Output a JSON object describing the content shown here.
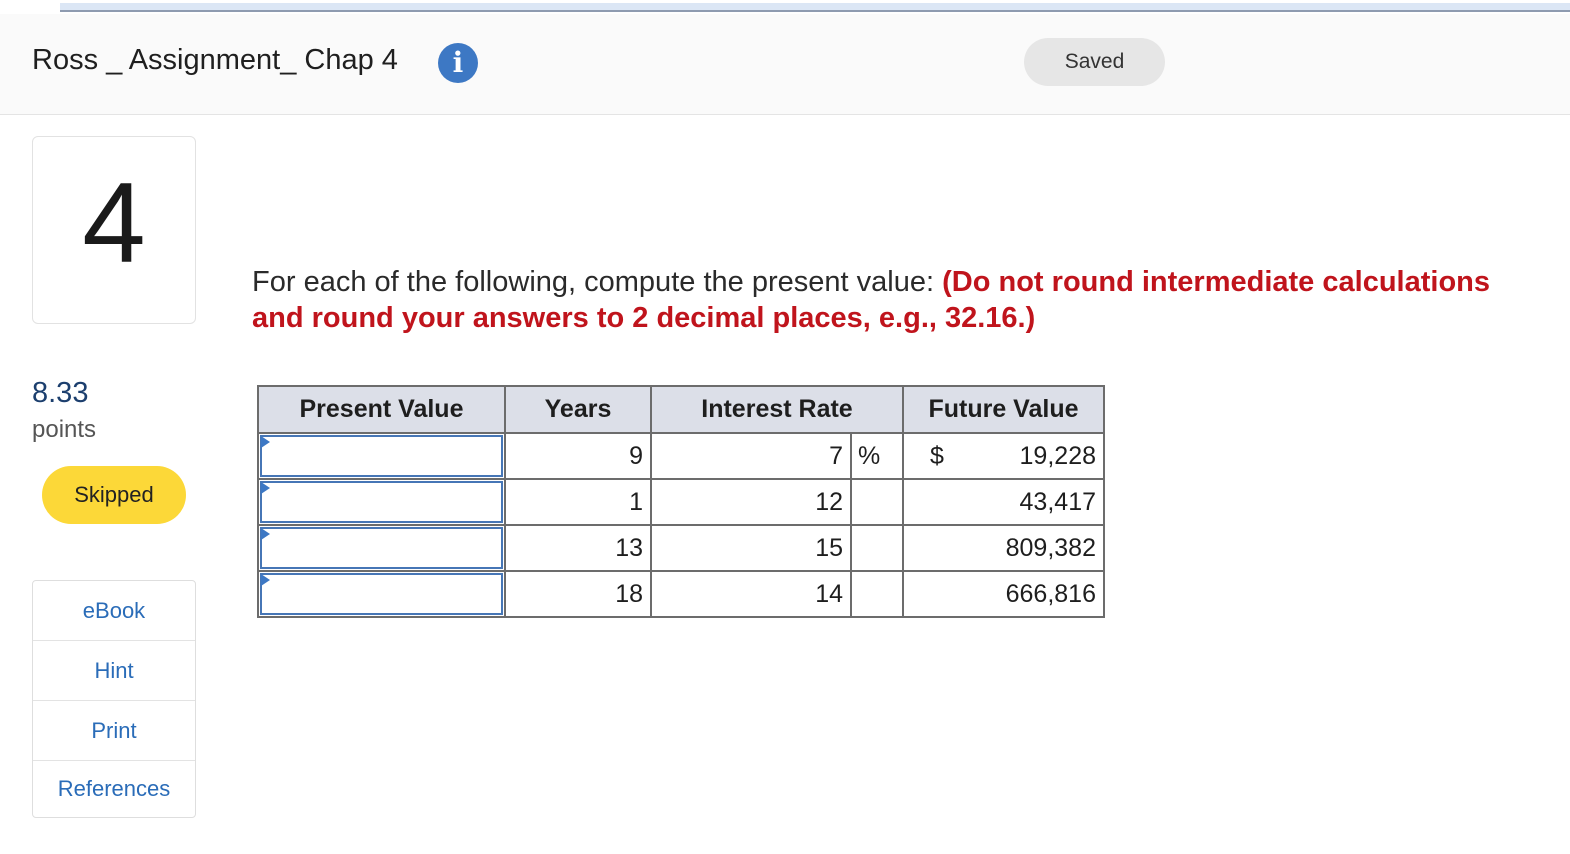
{
  "header": {
    "title": "Ross _ Assignment_ Chap 4",
    "info_icon": "info-icon",
    "status": "Saved"
  },
  "question": {
    "number": "4",
    "points_value": "8.33",
    "points_label": "points",
    "status_badge": "Skipped",
    "prompt": "For each of the following, compute the present value: ",
    "instruction": "(Do not round intermediate calculations and round your answers to 2 decimal places, e.g., 32.16.)"
  },
  "side_menu": {
    "items": [
      "eBook",
      "Hint",
      "Print",
      "References"
    ]
  },
  "table": {
    "headers": [
      "Present Value",
      "Years",
      "Interest Rate",
      "Future Value"
    ],
    "percent_sign": "%",
    "dollar_sign": "$",
    "rows": [
      {
        "present_value": "",
        "years": "9",
        "rate": "7",
        "future_value": "19,228"
      },
      {
        "present_value": "",
        "years": "1",
        "rate": "12",
        "future_value": "43,417"
      },
      {
        "present_value": "",
        "years": "13",
        "rate": "15",
        "future_value": "809,382"
      },
      {
        "present_value": "",
        "years": "18",
        "rate": "14",
        "future_value": "666,816"
      }
    ]
  },
  "colors": {
    "accent_blue": "#3d78c4",
    "skipped_yellow": "#fcd838",
    "instruction_red": "#c0141c",
    "header_gray": "#dcdfe8"
  }
}
